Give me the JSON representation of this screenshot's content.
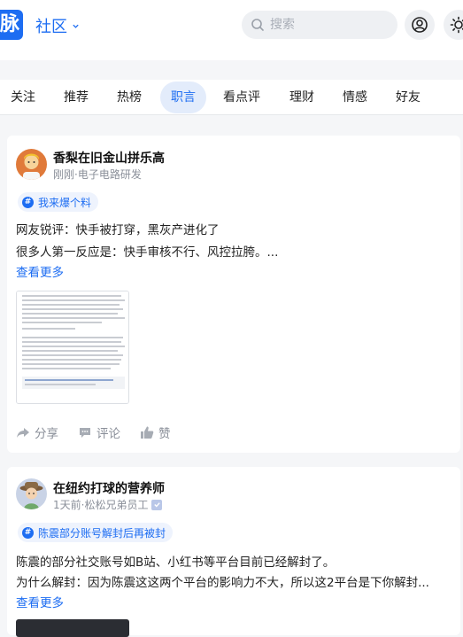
{
  "header": {
    "logo_text": "脉",
    "section_title": "社区",
    "search_placeholder": "搜索",
    "accent_color": "#1d6df2"
  },
  "tabs": [
    {
      "label": "关注",
      "active": false
    },
    {
      "label": "推荐",
      "active": false
    },
    {
      "label": "热榜",
      "active": false
    },
    {
      "label": "职言",
      "active": true
    },
    {
      "label": "看点评",
      "active": false
    },
    {
      "label": "理财",
      "active": false
    },
    {
      "label": "情感",
      "active": false
    },
    {
      "label": "好友",
      "active": false
    }
  ],
  "posts": [
    {
      "author": "香梨在旧金山拼乐高",
      "meta": "刚刚·电子电路研发",
      "tag": "我来爆个料",
      "lines": [
        "网友锐评：快手被打穿，黑灰产进化了",
        "很多人第一反应是：快手审核不行、风控拉胯。..."
      ],
      "more_label": "查看更多",
      "actions": {
        "share": "分享",
        "comment": "评论",
        "like": "赞"
      }
    },
    {
      "author": "在纽约打球的营养师",
      "meta": "1天前·松松兄弟员工",
      "tag": "陈震部分账号解封后再被封",
      "lines": [
        "陈震的部分社交账号如B站、小红书等平台目前已经解封了。",
        "为什么解封：因为陈震这这两个平台的影响力不大，所以这2平台是下你解封..."
      ],
      "more_label": "查看更多"
    }
  ]
}
